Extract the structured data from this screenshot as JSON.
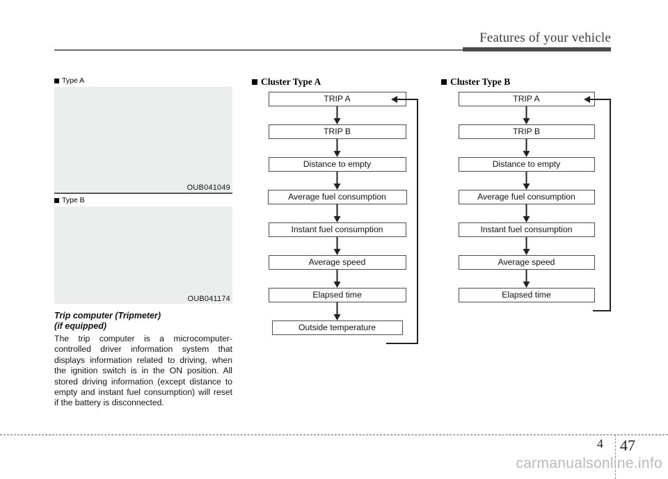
{
  "header": {
    "title": "Features of your vehicle"
  },
  "left_column": {
    "figures": [
      {
        "caption": "Type A",
        "code": "OUB041049"
      },
      {
        "caption": "Type B",
        "code": "OUB041174"
      }
    ],
    "section_title_line1": "Trip computer (Tripmeter)",
    "section_title_line2": "(if equipped)",
    "body_text": "The trip computer is a microcomputer-controlled driver information system that displays information related to driving, when the ignition switch is in the ON position. All stored driving information (except distance to empty and instant fuel consumption) will reset if the battery is disconnected."
  },
  "flowcharts": [
    {
      "title": "Cluster Type A",
      "nodes": [
        "TRIP A",
        "TRIP B",
        "Distance to empty",
        "Average fuel consumption",
        "Instant fuel consumption",
        "Average speed",
        "Elapsed time",
        "Outside temperature"
      ]
    },
    {
      "title": "Cluster Type B",
      "nodes": [
        "TRIP A",
        "TRIP B",
        "Distance to empty",
        "Average fuel consumption",
        "Instant fuel consumption",
        "Average speed",
        "Elapsed time"
      ]
    }
  ],
  "footer": {
    "chapter": "4",
    "page": "47",
    "watermark": "carmanualsonline.info"
  }
}
